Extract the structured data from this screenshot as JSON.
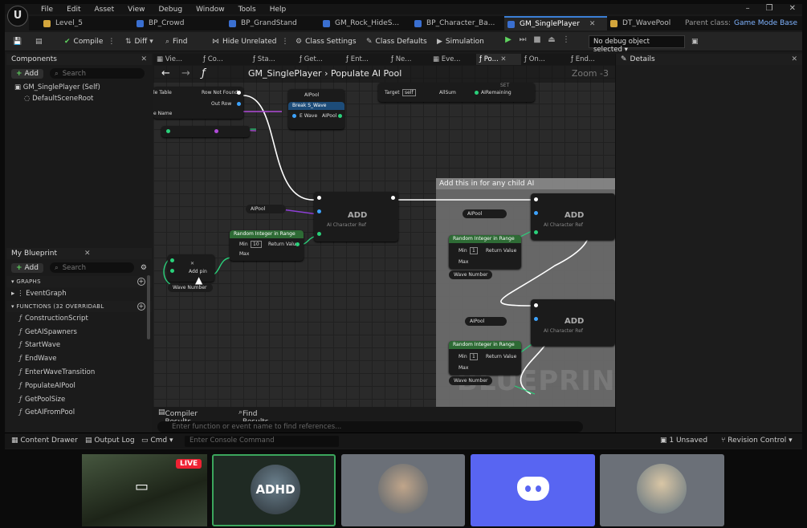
{
  "menu": [
    "File",
    "Edit",
    "Asset",
    "View",
    "Debug",
    "Window",
    "Tools",
    "Help"
  ],
  "tabs": [
    {
      "label": "Level_5",
      "color": "#d2a53c"
    },
    {
      "label": "BP_Crowd",
      "color": "#3a6fd0"
    },
    {
      "label": "BP_GrandStand",
      "color": "#3a6fd0"
    },
    {
      "label": "GM_Rock_HideS...",
      "color": "#3a6fd0"
    },
    {
      "label": "BP_Character_Ba...",
      "color": "#3a6fd0"
    },
    {
      "label": "GM_SinglePlayer",
      "color": "#3a6fd0"
    },
    {
      "label": "DT_WavePool",
      "color": "#d2a53c"
    }
  ],
  "parent_class": {
    "label": "Parent class:",
    "value": "Game Mode Base"
  },
  "toolbar": {
    "compile": "Compile",
    "diff": "Diff",
    "find": "Find",
    "hide_unrelated": "Hide Unrelated",
    "class_settings": "Class Settings",
    "class_defaults": "Class Defaults",
    "simulation": "Simulation",
    "debug_object": "No debug object selected"
  },
  "components": {
    "title": "Components",
    "add": "Add",
    "search": "Search",
    "items": [
      "GM_SinglePlayer (Self)",
      "DefaultSceneRoot"
    ]
  },
  "my_blueprint": {
    "title": "My Blueprint",
    "add": "Add",
    "search": "Search",
    "graphs_header": "GRAPHS",
    "graphs": [
      "EventGraph"
    ],
    "functions_header": "FUNCTIONS",
    "functions_count": "(32 OVERRIDABL",
    "functions": [
      "ConstructionScript",
      "GetAISpawners",
      "StartWave",
      "EndWave",
      "EnterWaveTransition",
      "PopulateAIPool",
      "GetPoolSize",
      "GetAIFromPool"
    ]
  },
  "graph_tabs": [
    "Vie...",
    "Co...",
    "Sta...",
    "Get...",
    "Ent...",
    "Ne...",
    "Eve...",
    "Po...",
    "On...",
    "End..."
  ],
  "breadcrumb": {
    "root": "GM_SinglePlayer",
    "sep": "›",
    "current": "Populate AI Pool",
    "zoom": "Zoom -3"
  },
  "comment_title": "Add this in for any child AI",
  "watermark": "BLUEPRINT",
  "nodes": {
    "row_not_found": "Row Not Found",
    "out_row": "Out Row",
    "le_table": "le Table",
    "le_name": "e Name",
    "break_wave": "Break S_Wave",
    "ai_pool": "AIPool",
    "e_wave": "E Wave",
    "target": "Target",
    "self": "self",
    "all_sum": "AllSum",
    "ai_remaining": "AIRemaining",
    "set": "SET",
    "add": "ADD",
    "random_int": "Random Integer in Range",
    "min": "Min",
    "max": "Max",
    "return_value": "Return Value",
    "wave_number": "Wave Number",
    "add_pin": "Add pin",
    "ai_char_ref": "AI Character Ref",
    "min_a": "10",
    "min_b": "1",
    "min_c": "1"
  },
  "bottom_tabs": {
    "compiler": "Compiler Results",
    "find": "Find Results"
  },
  "find_placeholder": "Enter function or event name to find references...",
  "details_title": "Details",
  "status": {
    "content_drawer": "Content Drawer",
    "output_log": "Output Log",
    "cmd": "Cmd",
    "console_placeholder": "Enter Console Command",
    "unsaved": "1 Unsaved",
    "revision": "Revision Control"
  },
  "call": {
    "live": "LIVE",
    "adhd": "ADHD"
  }
}
